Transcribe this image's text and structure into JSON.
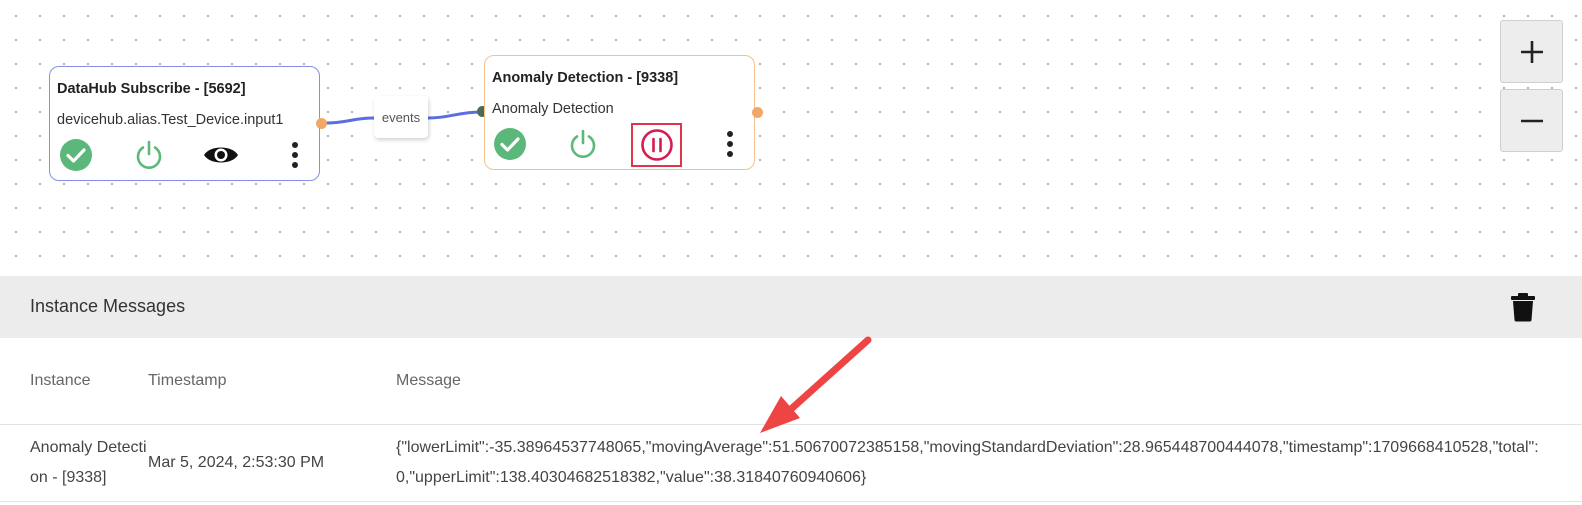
{
  "flow": {
    "subscribe_node": {
      "title": "DataHub Subscribe - [5692]",
      "subtitle": "devicehub.alias.Test_Device.input1",
      "icons": [
        "check-circle-icon",
        "power-icon",
        "eye-icon",
        "more-vertical-icon"
      ]
    },
    "edge_label": "events",
    "anomaly_node": {
      "title": "Anomaly Detection - [9338]",
      "subtitle": "Anomaly Detection",
      "icons": [
        "check-circle-icon",
        "power-icon",
        "pause-circle-icon",
        "more-vertical-icon"
      ]
    },
    "zoom_in_label": "+",
    "zoom_out_label": "−"
  },
  "messages_panel": {
    "title": "Instance Messages",
    "columns": [
      "Instance",
      "Timestamp",
      "Message"
    ],
    "rows": [
      {
        "instance": "Anomaly Detection - [9338]",
        "timestamp": "Mar 5, 2024, 2:53:30 PM",
        "message": "{\"lowerLimit\":-35.38964537748065,\"movingAverage\":51.50670072385158,\"movingStandardDeviation\":28.965448700444078,\"timestamp\":1709668410528,\"total\":0,\"upperLimit\":138.40304682518382,\"value\":38.31840760940606}"
      }
    ]
  },
  "colors": {
    "success": "#5cb87a",
    "pause": "#d81b4f",
    "highlight_box": "#e0344d",
    "edge": "#5b6ee1",
    "annotation_arrow": "#ef4444"
  }
}
